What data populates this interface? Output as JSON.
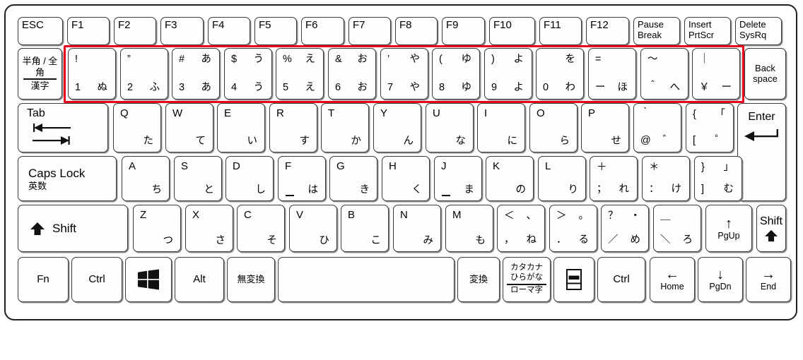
{
  "diagram": {
    "title": "Japanese JIS laptop keyboard layout",
    "highlight_color": "#e8001c",
    "highlight_label": "number-row-highlight"
  },
  "rows": {
    "function_row": [
      {
        "name": "esc",
        "label": "ESC"
      },
      {
        "name": "f1",
        "label": "F1"
      },
      {
        "name": "f2",
        "label": "F2"
      },
      {
        "name": "f3",
        "label": "F3"
      },
      {
        "name": "f4",
        "label": "F4"
      },
      {
        "name": "f5",
        "label": "F5"
      },
      {
        "name": "f6",
        "label": "F6"
      },
      {
        "name": "f7",
        "label": "F7"
      },
      {
        "name": "f8",
        "label": "F8"
      },
      {
        "name": "f9",
        "label": "F9"
      },
      {
        "name": "f10",
        "label": "F10"
      },
      {
        "name": "f11",
        "label": "F11"
      },
      {
        "name": "f12",
        "label": "F12"
      },
      {
        "name": "pause-break",
        "label": "Pause\nBreak"
      },
      {
        "name": "insert-prtscr",
        "label": "Insert\nPrtScr"
      },
      {
        "name": "delete-sysrq",
        "label": "Delete\nSysRq"
      }
    ],
    "number_row": {
      "hankaku_key": {
        "name": "hankaku-zenkaku-kanji",
        "top": "半角 /\n全角",
        "bottom": "漢字"
      },
      "keys": [
        {
          "name": "key-1",
          "tl": "!",
          "tr": "",
          "bl": "1",
          "br": "ぬ"
        },
        {
          "name": "key-2",
          "tl": "”",
          "tr": "",
          "bl": "2",
          "br": "ふ"
        },
        {
          "name": "key-3",
          "tl": "#",
          "tr": "あ",
          "bl": "3",
          "br": "あ"
        },
        {
          "name": "key-4",
          "tl": "$",
          "tr": "う",
          "bl": "4",
          "br": "う"
        },
        {
          "name": "key-5",
          "tl": "%",
          "tr": "え",
          "bl": "5",
          "br": "え"
        },
        {
          "name": "key-6",
          "tl": "&",
          "tr": "お",
          "bl": "6",
          "br": "お"
        },
        {
          "name": "key-7",
          "tl": "’",
          "tr": "や",
          "bl": "7",
          "br": "や"
        },
        {
          "name": "key-8",
          "tl": "(",
          "tr": "ゆ",
          "bl": "8",
          "br": "ゆ"
        },
        {
          "name": "key-9",
          "tl": ")",
          "tr": "よ",
          "bl": "9",
          "br": "よ"
        },
        {
          "name": "key-0",
          "tl": "",
          "tr": "を",
          "bl": "0",
          "br": "わ"
        },
        {
          "name": "key-minus",
          "tl": "=",
          "tr": "",
          "bl": "ー",
          "br": "ほ"
        },
        {
          "name": "key-caret",
          "tl": "～",
          "tr": "",
          "bl": "＾",
          "br": "へ"
        },
        {
          "name": "key-yen",
          "tl": "｜",
          "tr": "",
          "bl": "￥",
          "br": "ー"
        }
      ],
      "backspace": {
        "name": "backspace",
        "label": "Back\nspace"
      }
    },
    "qwerty_row": {
      "tab": {
        "name": "tab",
        "label": "Tab"
      },
      "keys": [
        {
          "name": "key-q",
          "letter": "Q",
          "kana": "た"
        },
        {
          "name": "key-w",
          "letter": "W",
          "kana": "て"
        },
        {
          "name": "key-e",
          "letter": "E",
          "kana": "い"
        },
        {
          "name": "key-r",
          "letter": "R",
          "kana": "す"
        },
        {
          "name": "key-t",
          "letter": "T",
          "kana": "か"
        },
        {
          "name": "key-y",
          "letter": "Y",
          "kana": "ん"
        },
        {
          "name": "key-u",
          "letter": "U",
          "kana": "な"
        },
        {
          "name": "key-i",
          "letter": "I",
          "kana": "に"
        },
        {
          "name": "key-o",
          "letter": "O",
          "kana": "ら"
        },
        {
          "name": "key-p",
          "letter": "P",
          "kana": "せ"
        }
      ],
      "symbol_keys": [
        {
          "name": "key-at",
          "tl": "｀",
          "tr": "",
          "bl": "@",
          "br": "゛"
        },
        {
          "name": "key-bracket-left",
          "tl": "{",
          "tr": "「",
          "bl": "[",
          "br": "゜"
        }
      ],
      "enter": {
        "name": "enter",
        "label": "Enter"
      }
    },
    "home_row": {
      "caps": {
        "name": "caps-lock",
        "l1": "Caps Lock",
        "l2": "英数"
      },
      "keys": [
        {
          "name": "key-a",
          "letter": "A",
          "kana": "ち",
          "homing": false
        },
        {
          "name": "key-s",
          "letter": "S",
          "kana": "と",
          "homing": false
        },
        {
          "name": "key-d",
          "letter": "D",
          "kana": "し",
          "homing": false
        },
        {
          "name": "key-f",
          "letter": "F",
          "kana": "は",
          "homing": true
        },
        {
          "name": "key-g",
          "letter": "G",
          "kana": "き",
          "homing": false
        },
        {
          "name": "key-h",
          "letter": "H",
          "kana": "く",
          "homing": false
        },
        {
          "name": "key-j",
          "letter": "J",
          "kana": "ま",
          "homing": true
        },
        {
          "name": "key-k",
          "letter": "K",
          "kana": "の",
          "homing": false
        },
        {
          "name": "key-l",
          "letter": "L",
          "kana": "り",
          "homing": false
        }
      ],
      "symbol_keys": [
        {
          "name": "key-semicolon",
          "tl": "＋",
          "tr": "",
          "bl": "；",
          "br": "れ"
        },
        {
          "name": "key-colon",
          "tl": "＊",
          "tr": "",
          "bl": "：",
          "br": "け"
        },
        {
          "name": "key-bracket-right",
          "tl": "}",
          "tr": "」",
          "bl": "]",
          "br": "む"
        }
      ]
    },
    "shift_row": {
      "shift_left": {
        "name": "shift-left",
        "label": "Shift"
      },
      "keys": [
        {
          "name": "key-z",
          "letter": "Z",
          "kana": "つ"
        },
        {
          "name": "key-x",
          "letter": "X",
          "kana": "さ"
        },
        {
          "name": "key-c",
          "letter": "C",
          "kana": "そ"
        },
        {
          "name": "key-v",
          "letter": "V",
          "kana": "ひ"
        },
        {
          "name": "key-b",
          "letter": "B",
          "kana": "こ"
        },
        {
          "name": "key-n",
          "letter": "N",
          "kana": "み"
        },
        {
          "name": "key-m",
          "letter": "M",
          "kana": "も"
        }
      ],
      "symbol_keys": [
        {
          "name": "key-comma",
          "tl": "＜",
          "tr": "、",
          "bl": "，",
          "br": "ね"
        },
        {
          "name": "key-period",
          "tl": "＞",
          "tr": "。",
          "bl": "．",
          "br": "る"
        },
        {
          "name": "key-slash",
          "tl": "？",
          "tr": "・",
          "bl": "／",
          "br": "め"
        },
        {
          "name": "key-backslash",
          "tl": "＿",
          "tr": "",
          "bl": "＼",
          "br": "ろ"
        }
      ],
      "pgup": {
        "name": "arrow-up-pgup",
        "glyph": "↑",
        "label": "PgUp"
      },
      "shift_right": {
        "name": "shift-right",
        "label": "Shift"
      }
    },
    "bottom_row": {
      "fn": {
        "name": "fn",
        "label": "Fn"
      },
      "ctrl_left": {
        "name": "ctrl-left",
        "label": "Ctrl"
      },
      "windows": {
        "name": "windows-key",
        "label": ""
      },
      "alt": {
        "name": "alt",
        "label": "Alt"
      },
      "muhenkan": {
        "name": "muhenkan",
        "label": "無変換"
      },
      "space": {
        "name": "space",
        "label": ""
      },
      "henkan": {
        "name": "henkan",
        "label": "変換"
      },
      "katakana": {
        "name": "katakana-hiragana-romaji",
        "l1": "カタカナ",
        "l2": "ひらがな",
        "l3": "ローマ字"
      },
      "menu": {
        "name": "menu-key",
        "label": ""
      },
      "ctrl_right": {
        "name": "ctrl-right",
        "label": "Ctrl"
      },
      "home": {
        "name": "arrow-left-home",
        "glyph": "←",
        "label": "Home"
      },
      "pgdn": {
        "name": "arrow-down-pgdn",
        "glyph": "↓",
        "label": "PgDn"
      },
      "end": {
        "name": "arrow-right-end",
        "glyph": "→",
        "label": "End"
      }
    }
  }
}
